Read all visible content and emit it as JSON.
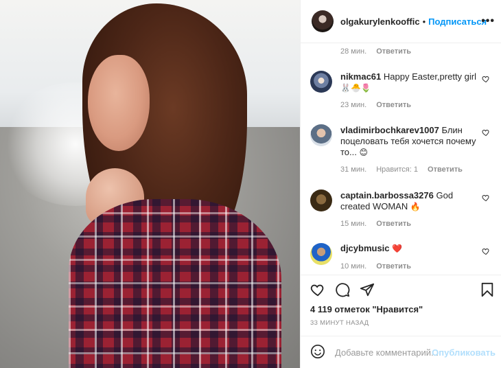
{
  "post": {
    "username": "olgakurylenkooffic",
    "separator": "•",
    "follow_label": "Подписаться",
    "more_label": "•••"
  },
  "top_meta": {
    "time": "28 мин.",
    "reply": "Ответить"
  },
  "comments": [
    {
      "username": "nikmac61",
      "text": "Happy Easter,pretty girl",
      "emoji": "🐰🐣🌷",
      "time": "23 мин.",
      "likes": "",
      "reply": "Ответить"
    },
    {
      "username": "vladimirbochkarev1007",
      "text": "Блин поцеловать тебя хочется почему то...",
      "emoji": "😊",
      "time": "31 мин.",
      "likes": "Нравится: 1",
      "reply": "Ответить"
    },
    {
      "username": "captain.barbossa3276",
      "text": "God created WOMAN",
      "emoji": "🔥",
      "time": "15 мин.",
      "likes": "",
      "reply": "Ответить"
    },
    {
      "username": "djcybmusic",
      "text": "",
      "emoji": "❤️",
      "time": "10 мин.",
      "likes": "",
      "reply": "Ответить"
    }
  ],
  "likes_count": "4 119 отметок \"Нравится\"",
  "posted_time": "33 МИНУТ НАЗАД",
  "composer": {
    "placeholder": "Добавьте комментарий...",
    "post_label": "Опубликовать"
  },
  "icons": [
    "heart-icon",
    "comment-icon",
    "share-icon",
    "bookmark-icon",
    "emoji-icon",
    "more-icon"
  ],
  "colors": {
    "accent": "#0095f6",
    "muted": "#8e8e8e",
    "text": "#262626",
    "post_disabled": "#b2dffc"
  }
}
